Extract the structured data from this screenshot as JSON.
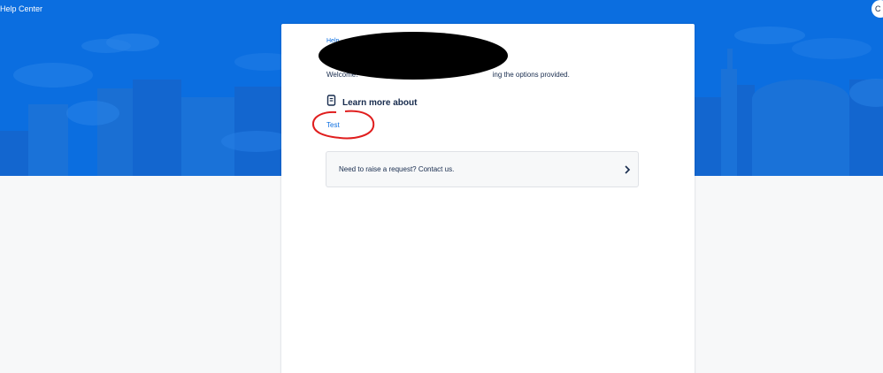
{
  "header": {
    "title": "Help Center",
    "avatar_initial": "C"
  },
  "card": {
    "breadcrumb": "Help",
    "welcome_text_start": "Welcome! ",
    "welcome_text_end": "ing the options provided.",
    "section_title": "Learn more about",
    "section_icon": "document-icon",
    "topic_link": "Test",
    "request_prompt": "Need to raise a request? Contact us.",
    "request_icon": "chevron-right-icon"
  },
  "annotations": {
    "redaction": "black ellipse",
    "highlight": "red hand-drawn circle"
  },
  "colors": {
    "banner": "#0b6ee0",
    "link": "#0b6ee0",
    "text": "#172b4d",
    "annotation": "#e01e1e",
    "redaction": "#000000"
  }
}
